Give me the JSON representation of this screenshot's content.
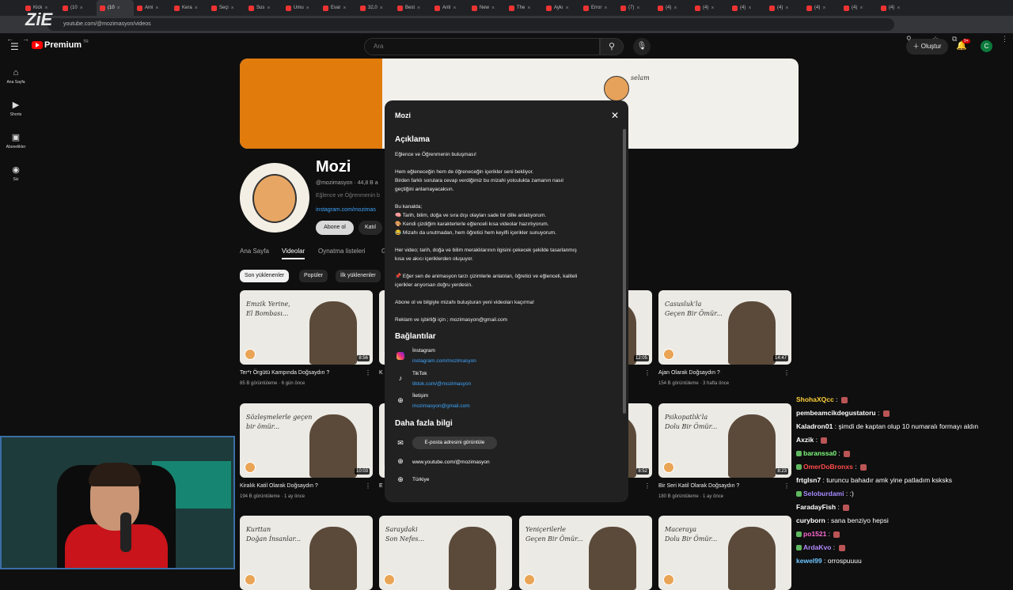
{
  "browser": {
    "tabs": [
      "Kick",
      "(10",
      "(10",
      "Ami",
      "Kera",
      "Seçi",
      "Sus",
      "Umu",
      "Evar",
      "32,0",
      "Best",
      "Anti",
      "New",
      "The",
      "Aykı",
      "Error",
      "(7)",
      "(4)",
      "(4)",
      "(4)",
      "(4)",
      "(4)",
      "(4)",
      "(4)"
    ],
    "url": "youtube.com/@mozimasyon/videos",
    "overlay_logo": "ZiE"
  },
  "yt_header": {
    "logo_text": "Premium",
    "region": "TR",
    "search_placeholder": "Ara",
    "create_label": "Oluştur",
    "notif_count": "9+",
    "avatar_letter": "C"
  },
  "sidebar": {
    "items": [
      {
        "label": "Ana Sayfa",
        "icon": "home-icon"
      },
      {
        "label": "Shorts",
        "icon": "shorts-icon"
      },
      {
        "label": "Abonelikler",
        "icon": "subscriptions-icon"
      },
      {
        "label": "Siz",
        "icon": "you-icon"
      }
    ]
  },
  "channel": {
    "name": "Mozi",
    "handle": "@mozimasyon · 44,8 B a",
    "desc_preview": "Eğlence ve Öğrenmenin b",
    "link_preview": "instagram.com/mozimas",
    "subscribe_label": "Abone ol",
    "join_label": "Katıl",
    "banner_text": "selam",
    "tabs": [
      "Ana Sayfa",
      "Videolar",
      "Oynatma listeleri",
      "G"
    ],
    "active_tab": "Videolar",
    "chips": [
      "Son yüklenenler",
      "Popüler",
      "İlk yüklenenler"
    ]
  },
  "videos": [
    {
      "thumb_text": "Emzik Yerine,\nEl Bombası...",
      "duration": "8:56",
      "title": "Ter*r Örgütü Kampında Doğsaydın ?",
      "meta": "85 B görüntüleme · 6 gün önce"
    },
    {
      "thumb_text": "",
      "duration": "",
      "title": "K",
      "meta": ""
    },
    {
      "thumb_text": "",
      "duration": "12:05",
      "title": "",
      "meta": ""
    },
    {
      "thumb_text": "Casusluk'la\nGeçen Bir Ömür...",
      "duration": "14:47",
      "title": "Ajan Olarak Doğsaydın ?",
      "meta": "154 B görüntüleme · 3 hafta önce"
    },
    {
      "thumb_text": "Sözleşmelerle geçen\nbir ömür...",
      "duration": "10:03",
      "title": "Kiralık Katil Olarak Doğsaydın ?",
      "meta": "194 B görüntüleme · 1 ay önce"
    },
    {
      "thumb_text": "",
      "duration": "",
      "title": "E",
      "meta": ""
    },
    {
      "thumb_text": "",
      "duration": "8:52",
      "title": "",
      "meta": ""
    },
    {
      "thumb_text": "Psikopatlık'la\nDolu Bir Ömür...",
      "duration": "8:23",
      "title": "Bir Seri Katil Olarak Doğsaydın ?",
      "meta": "180 B görüntüleme · 1 ay önce"
    },
    {
      "thumb_text": "Kurttan\nDoğan İnsanlar...",
      "duration": "",
      "title": "",
      "meta": ""
    },
    {
      "thumb_text": "Saraydaki\nSon Nefes...",
      "duration": "",
      "title": "",
      "meta": ""
    },
    {
      "thumb_text": "Yeniçerilerle\nGeçen Bir Ömür...",
      "duration": "",
      "title": "",
      "meta": ""
    },
    {
      "thumb_text": "Maceraya\nDolu Bir Ömür...",
      "duration": "",
      "title": "",
      "meta": ""
    }
  ],
  "modal": {
    "title": "Mozi",
    "close_icon": "close-icon",
    "section_description": "Açıklama",
    "desc_lines": [
      "Eğlence ve Öğrenmenin buluşması!",
      "",
      "Hem eğleneceğin hem de öğreneceğin içerikler seni bekliyor.",
      "Birden farklı sorulara cevap verdiğimiz bu mizahi yolculukta zamanın nasıl",
      "geçtiğini anlamayacaksın.",
      "",
      "Bu kanalda;",
      "🧠 Tarih, bilim, doğa ve sıra dışı olayları sade bir dille anlatıyorum.",
      "🎨 Kendi çizdiğim karakterlerle eğlenceli kısa videolar hazırlıyorum.",
      "😂 Mizahı da unutmadan, hem öğretici hem keyifli içerikler sunuyorum.",
      "",
      "Her video; tarih, doğa ve bilim meraklılarının ilgisini çekecek şekilde tasarlanmış",
      "kısa ve akıcı içeriklerden oluşuyor.",
      "",
      "📌 Eğer sen de animasyon tarzı çizimlerle anlatılan, öğretici ve eğlenceli, kaliteli",
      "içerikler arıyorsan doğru yerdesin.",
      "",
      "Abone ol ve bilgiyle mizahı buluşturan yeni videoları kaçırma!",
      "",
      "Reklam ve işbirliği için ; mozimasyon@gmail.com"
    ],
    "section_links": "Bağlantılar",
    "links": [
      {
        "name": "İnstagram",
        "url": "instagram.com/mozimasyon",
        "icon": "instagram-icon"
      },
      {
        "name": "TikTok",
        "url": "tiktok.com/@mozimasyon",
        "icon": "tiktok-icon"
      },
      {
        "name": "İletişim",
        "url": "mozimasyon@gmail.com",
        "icon": "globe-icon"
      }
    ],
    "section_more": "Daha fazla bilgi",
    "email_button": "E-posta adresini görüntüle",
    "channel_url": "www.youtube.com/@mozimasyon",
    "country": "Türkiye"
  },
  "chat": [
    {
      "user": "ShohaXQcc",
      "msg": "",
      "color": "#ffd23b"
    },
    {
      "user": "pembeamcikdegustatoru",
      "msg": "",
      "color": "#ffffff"
    },
    {
      "user": "Kaladron01",
      "msg": "şimdi de kaptan olup 10 numaralı formayı aldın",
      "color": "#ffffff"
    },
    {
      "user": "Axzik",
      "msg": "",
      "color": "#ffffff"
    },
    {
      "user": "baranssa0",
      "msg": "",
      "color": "#7cfc7c"
    },
    {
      "user": "OmerDoBronxs",
      "msg": "",
      "color": "#ff4b4b"
    },
    {
      "user": "frtglsn7",
      "msg": "turuncu bahadır amk yine patladım ksksks",
      "color": "#ffffff"
    },
    {
      "user": "Seloburdami",
      "msg": ":)",
      "color": "#a78bff"
    },
    {
      "user": "FaradayFish",
      "msg": "",
      "color": "#ffffff"
    },
    {
      "user": "curyborn",
      "msg": "sana benziyo hepsi",
      "color": "#ffffff"
    },
    {
      "user": "po1521",
      "msg": "",
      "color": "#ff6ad5"
    },
    {
      "user": "ArdaKvo",
      "msg": "",
      "color": "#b48bff"
    },
    {
      "user": "kewel99",
      "msg": "orrospuuuu",
      "color": "#6ec6ff"
    }
  ]
}
